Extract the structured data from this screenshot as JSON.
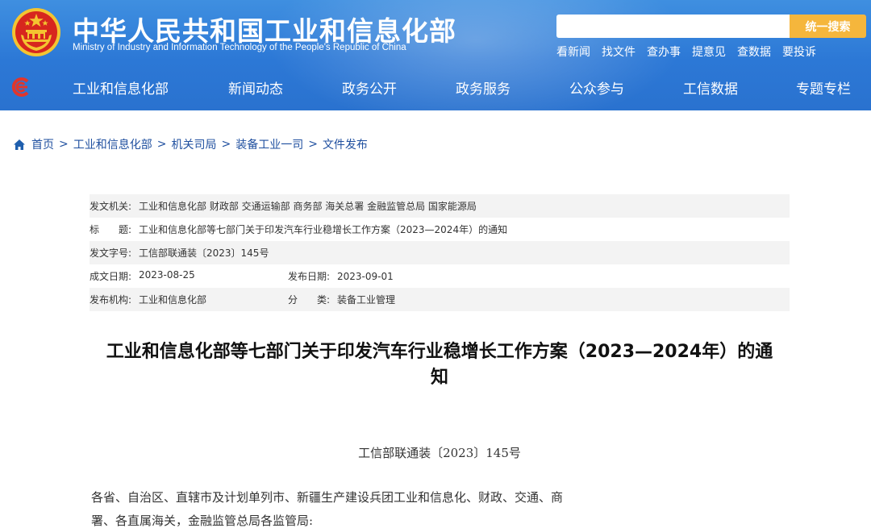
{
  "header": {
    "title": "中华人民共和国工业和信息化部",
    "subtitle": "Ministry of Industry and Information Technology of the People's Republic of China",
    "search": {
      "placeholder": "",
      "button_label": "统一搜索"
    },
    "quick_links": [
      "看新闻",
      "找文件",
      "查办事",
      "提意见",
      "查数据",
      "要投诉"
    ],
    "nav": [
      "工业和信息化部",
      "新闻动态",
      "政务公开",
      "政务服务",
      "公众参与",
      "工信数据",
      "专题专栏"
    ],
    "colors": {
      "header_blue": "#2c78d6",
      "search_button": "#f5b63c",
      "emblem_red": "#d7261e",
      "emblem_gold": "#f4c430"
    }
  },
  "breadcrumb": [
    "首页",
    "工业和信息化部",
    "机关司局",
    "装备工业一司",
    "文件发布"
  ],
  "info": {
    "issuer_label": "发文机关:",
    "issuer_value": "工业和信息化部 财政部 交通运输部 商务部 海关总署 金融监管总局 国家能源局",
    "title_label": "标　　题:",
    "title_value": "工业和信息化部等七部门关于印发汽车行业稳增长工作方案（2023—2024年）的通知",
    "docno_label": "发文字号:",
    "docno_value": "工信部联通装〔2023〕145号",
    "created_label": "成文日期:",
    "created_value": "2023-08-25",
    "published_label": "发布日期:",
    "published_value": "2023-09-01",
    "org_label": "发布机构:",
    "org_value": "工业和信息化部",
    "category_label": "分　　类:",
    "category_value": "装备工业管理"
  },
  "article": {
    "title_line1": "工业和信息化部等七部门关于印发汽车行业稳增长工作方案（2023—2024年）的通",
    "title_line2": "知",
    "doc_number": "工信部联通装〔2023〕145号",
    "body_line1": "各省、自治区、直辖市及计划单列市、新疆生产建设兵团工业和信息化、财政、交通、商",
    "body_line2": "署、各直属海关，金融监管总局各监管局:"
  }
}
